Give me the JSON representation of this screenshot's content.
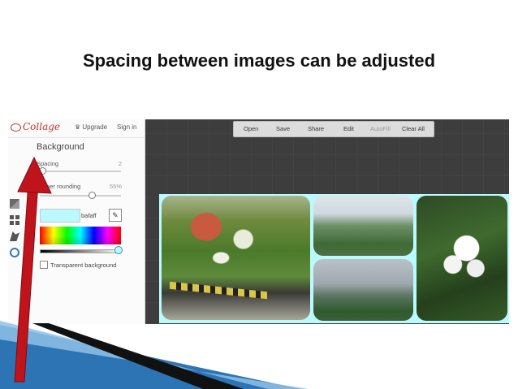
{
  "slide": {
    "title": "Spacing between images can be adjusted"
  },
  "app": {
    "logo": "Collage",
    "upgrade_label": "Upgrade",
    "signin_label": "Sign in"
  },
  "panel": {
    "heading": "Background",
    "spacing": {
      "label": "Spacing",
      "value": "2",
      "level_percent": 2
    },
    "corner_rounding": {
      "label": "Corner rounding",
      "value": "55%",
      "level_percent": 55
    },
    "color": {
      "hex": "bafaff",
      "swatch_color": "#bafaff"
    },
    "transparent_label": "Transparent background",
    "side_icons": [
      "image-icon",
      "layout-grid-icon",
      "shape-icon",
      "brush-icon"
    ]
  },
  "toolbar": {
    "items": [
      {
        "label": "Open",
        "enabled": true
      },
      {
        "label": "Save",
        "enabled": true
      },
      {
        "label": "Share",
        "enabled": true
      },
      {
        "label": "Edit",
        "enabled": true
      },
      {
        "label": "AutoFill",
        "enabled": false
      },
      {
        "label": "Clear All",
        "enabled": true
      }
    ]
  },
  "collage": {
    "background_color": "#bafaff",
    "images": [
      "garden-wall-photo",
      "valley-view-photo",
      "town-hills-photo",
      "white-flowers-photo"
    ]
  },
  "colors": {
    "annotation_arrow": "#c0141c",
    "accent_blue": "#3a8fb3"
  }
}
